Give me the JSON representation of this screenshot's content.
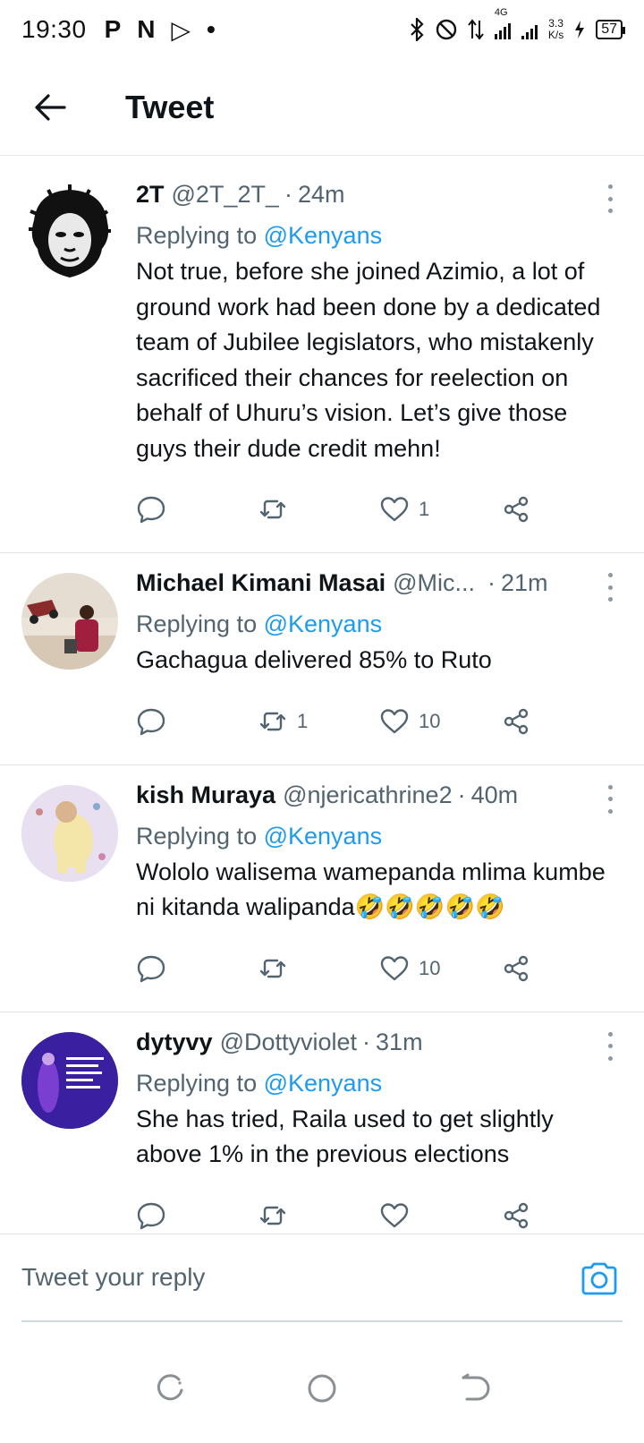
{
  "status_bar": {
    "time": "19:30",
    "app_icons": [
      "P",
      "N",
      "▷",
      "•"
    ],
    "network_type": "4G",
    "speed_value": "3.3",
    "speed_unit": "K/s",
    "battery": "57"
  },
  "header": {
    "title": "Tweet"
  },
  "tweets": [
    {
      "name": "2T",
      "handle": "@2T_2T_",
      "sep": "·",
      "time": "24m",
      "replying_prefix": "Replying to",
      "replying_to": "@Kenyans",
      "text": "Not true, before she joined Azimio, a lot of ground work had been done by a dedicated team of  Jubilee legislators, who mistakenly sacrificed their chances for reelection on behalf of Uhuru’s vision. Let’s give those guys their dude credit mehn!",
      "retweets": "",
      "likes": "1"
    },
    {
      "name": "Michael Kimani Masai",
      "handle": "@Mic...",
      "sep": "·",
      "time": "21m",
      "replying_prefix": "Replying to",
      "replying_to": "@Kenyans",
      "text": "Gachagua delivered 85% to Ruto",
      "retweets": "1",
      "likes": "10"
    },
    {
      "name": "kish Muraya",
      "handle": "@njericathrine2",
      "sep": "·",
      "time": "40m",
      "replying_prefix": "Replying to",
      "replying_to": "@Kenyans",
      "text": "Wololo walisema wamepanda mlima kumbe ni kitanda walipanda🤣🤣🤣🤣🤣",
      "retweets": "",
      "likes": "10"
    },
    {
      "name": "dytyvy",
      "handle": "@Dottyviolet",
      "sep": "·",
      "time": "31m",
      "replying_prefix": "Replying to",
      "replying_to": "@Kenyans",
      "text": "She has tried, Raila used to get slightly above 1% in the previous elections",
      "retweets": "",
      "likes": ""
    }
  ],
  "reply_bar": {
    "placeholder": "Tweet your reply"
  },
  "colors": {
    "accent": "#1d9bf0",
    "secondary_text": "#536471",
    "primary_text": "#0f1419"
  }
}
